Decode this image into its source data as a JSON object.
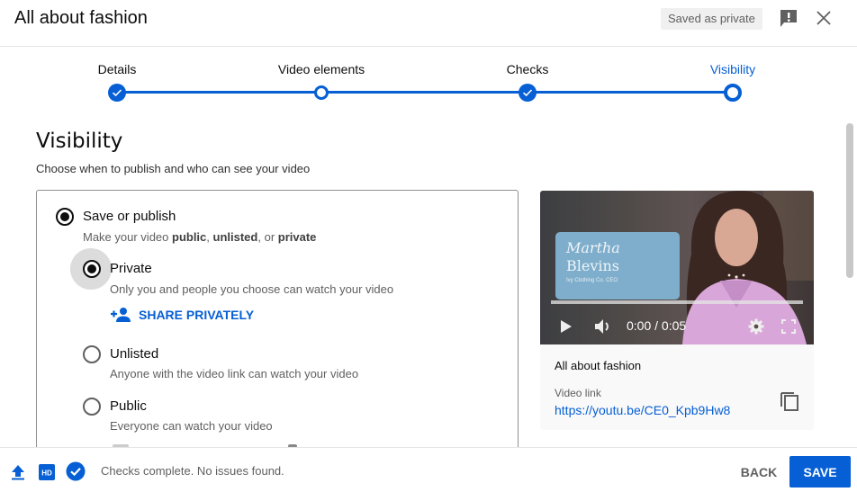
{
  "header": {
    "title": "All about fashion",
    "saved_badge": "Saved as private",
    "feedback_icon": "feedback-icon",
    "close_icon": "close-icon"
  },
  "stepper": {
    "steps": [
      {
        "label": "Details",
        "state": "complete"
      },
      {
        "label": "Video elements",
        "state": "incomplete"
      },
      {
        "label": "Checks",
        "state": "complete"
      },
      {
        "label": "Visibility",
        "state": "current"
      }
    ]
  },
  "visibility": {
    "title": "Visibility",
    "subtitle": "Choose when to publish and who can see your video",
    "save_or_publish": {
      "label": "Save or publish",
      "selected": true,
      "desc_prefix": "Make your video ",
      "desc_public": "public",
      "desc_sep1": ", ",
      "desc_unlisted": "unlisted",
      "desc_sep2": ", or ",
      "desc_private": "private"
    },
    "options": [
      {
        "label": "Private",
        "desc": "Only you and people you choose can watch your video",
        "selected": true
      },
      {
        "label": "Unlisted",
        "desc": "Anyone with the video link can watch your video",
        "selected": false
      },
      {
        "label": "Public",
        "desc": "Everyone can watch your video",
        "selected": false
      }
    ],
    "share_privately": "SHARE PRIVATELY"
  },
  "video_card": {
    "overlay_name_line1": "Martha",
    "overlay_name_line2": "Blevins",
    "overlay_role": "Ivy Clothing Co. CEO",
    "time": "0:00 / 0:05",
    "progress": 0,
    "video_title": "All about fashion",
    "link_label": "Video link",
    "link": "https://youtu.be/CE0_Kpb9Hw8"
  },
  "footer": {
    "status": "Checks complete. No issues found.",
    "back_label": "BACK",
    "save_label": "SAVE"
  },
  "colors": {
    "accent": "#065fd4"
  }
}
